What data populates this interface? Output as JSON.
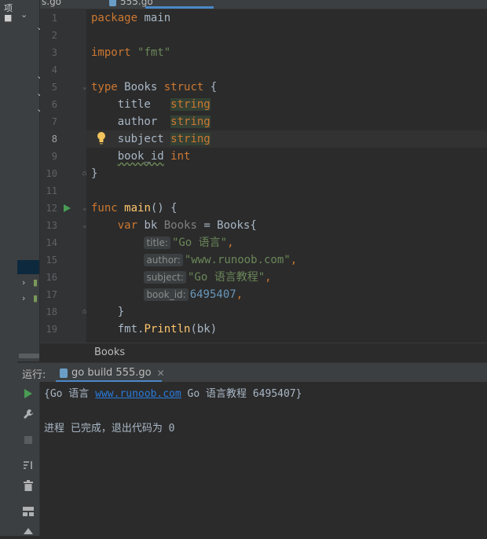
{
  "tabs": [
    {
      "label": "s.go",
      "active": false
    },
    {
      "label": "555.go",
      "active": true
    }
  ],
  "left_strip_glyphs": [
    "项",
    "■"
  ],
  "editor": {
    "current_line": 8,
    "lines": [
      {
        "n": 1,
        "tokens": [
          [
            "kw",
            "package"
          ],
          [
            "ty",
            " main"
          ]
        ]
      },
      {
        "n": 2,
        "tokens": []
      },
      {
        "n": 3,
        "tokens": [
          [
            "kw",
            "import"
          ],
          [
            "ty",
            " "
          ],
          [
            "str",
            "\"fmt\""
          ]
        ]
      },
      {
        "n": 4,
        "tokens": []
      },
      {
        "n": 5,
        "tokens": [
          [
            "kw",
            "type"
          ],
          [
            "ty",
            " Books "
          ],
          [
            "kw",
            "struct"
          ],
          [
            "ty",
            " {"
          ]
        ]
      },
      {
        "n": 6,
        "tokens": [
          [
            "ty",
            "    title   "
          ],
          [
            "strhl",
            "string"
          ]
        ]
      },
      {
        "n": 7,
        "tokens": [
          [
            "ty",
            "    author  "
          ],
          [
            "strhl",
            "string"
          ]
        ]
      },
      {
        "n": 8,
        "tokens": [
          [
            "ty",
            "    subject "
          ],
          [
            "strhl",
            "string"
          ]
        ]
      },
      {
        "n": 9,
        "tokens": [
          [
            "ty",
            "    "
          ],
          [
            "wavy",
            "book_id"
          ],
          [
            "ty",
            " "
          ],
          [
            "kw",
            "int"
          ]
        ]
      },
      {
        "n": 10,
        "tokens": [
          [
            "ty",
            "}"
          ]
        ]
      },
      {
        "n": 11,
        "tokens": []
      },
      {
        "n": 12,
        "tokens": [
          [
            "kw",
            "func"
          ],
          [
            "ty",
            " "
          ],
          [
            "fn",
            "main"
          ],
          [
            "ty",
            "() {"
          ]
        ]
      },
      {
        "n": 13,
        "tokens": [
          [
            "ty",
            "    "
          ],
          [
            "kw",
            "var"
          ],
          [
            "ty",
            " bk "
          ],
          [
            "tyg",
            "Books"
          ],
          [
            "ty",
            " = Books{"
          ]
        ]
      },
      {
        "n": 14,
        "tokens": [
          [
            "ty",
            "        "
          ],
          [
            "hint",
            "title:"
          ],
          [
            "str",
            "\"Go 语言\""
          ],
          [
            "kw",
            ","
          ]
        ]
      },
      {
        "n": 15,
        "tokens": [
          [
            "ty",
            "        "
          ],
          [
            "hint",
            "author:"
          ],
          [
            "str",
            "\"www.runoob.com\""
          ],
          [
            "kw",
            ","
          ]
        ]
      },
      {
        "n": 16,
        "tokens": [
          [
            "ty",
            "        "
          ],
          [
            "hint",
            "subject:"
          ],
          [
            "str",
            "\"Go 语言教程\""
          ],
          [
            "kw",
            ","
          ]
        ]
      },
      {
        "n": 17,
        "tokens": [
          [
            "ty",
            "        "
          ],
          [
            "hint",
            "book_id:"
          ],
          [
            "num",
            "6495407"
          ],
          [
            "kw",
            ","
          ]
        ]
      },
      {
        "n": 18,
        "tokens": [
          [
            "ty",
            "    }"
          ]
        ]
      },
      {
        "n": 19,
        "tokens": [
          [
            "ty",
            "    fmt."
          ],
          [
            "fn",
            "Println"
          ],
          [
            "ty",
            "(bk)"
          ]
        ]
      }
    ]
  },
  "breadcrumb": "Books",
  "run": {
    "label": "运行:",
    "tab_label": "go build 555.go",
    "output": {
      "prefix": "{Go 语言 ",
      "link": "www.runoob.com",
      "suffix": " Go 语言教程 6495407}",
      "exit": "进程 已完成，退出代码为 0"
    }
  },
  "icons": {
    "run_tool_icons": [
      "play-icon",
      "wrench-icon",
      "stop-icon",
      "sort-icon",
      "trash-icon",
      "layout-icon",
      "pin-icon"
    ]
  }
}
